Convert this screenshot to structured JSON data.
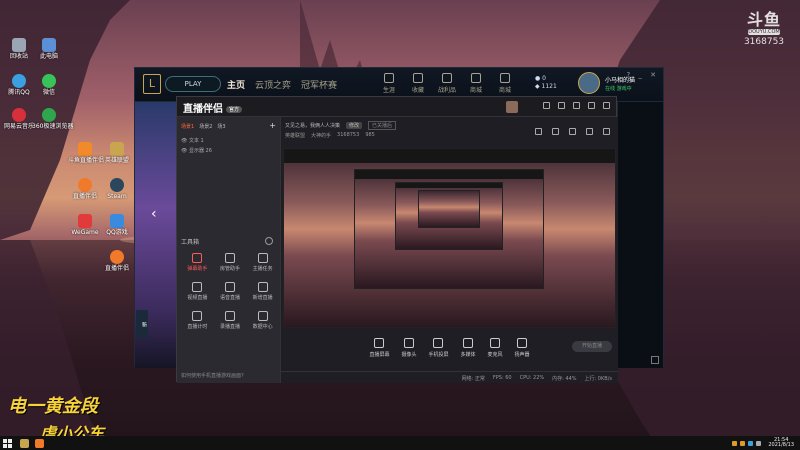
{
  "desktop": {
    "icons": [
      {
        "label": "回收站",
        "color": "#9aa5b5"
      },
      {
        "label": "此电脑",
        "color": "#5b8fd6"
      },
      {
        "label": "腾讯QQ",
        "color": "#3aa0e0"
      },
      {
        "label": "微信",
        "color": "#38c35a"
      },
      {
        "label": "网易云音乐",
        "color": "#d8303a"
      },
      {
        "label": "360极速浏览器",
        "color": "#2fa54e"
      },
      {
        "label": "斗鱼直播伴侣",
        "color": "#f08a2a"
      },
      {
        "label": "英雄联盟",
        "color": "#c8a650"
      },
      {
        "label": "直播伴侣",
        "color": "#f07a2a"
      },
      {
        "label": "Steam",
        "color": "#2a475e"
      },
      {
        "label": "WeGame",
        "color": "#e23a3a"
      },
      {
        "label": "QQ游戏",
        "color": "#3a8ae0"
      },
      {
        "label": "直播伴侣",
        "color": "#f07a2a"
      }
    ],
    "watermark": {
      "logo_text": "斗鱼",
      "sub": "DOUYU.COM",
      "room_number": "3168753"
    },
    "calligraphy": {
      "line1": "电一黄金段",
      "line2": "虐小公车"
    }
  },
  "taskbar": {
    "time": "21:54",
    "date": "2021/8/13"
  },
  "lol_client": {
    "play_label": "PLAY",
    "nav": [
      "主页",
      "云顶之弈",
      "冠军杯赛"
    ],
    "icons": [
      "生涯",
      "收藏",
      "战利品",
      "商城",
      "商城"
    ],
    "currency": {
      "be": "0",
      "rp": "1121"
    },
    "player_name": "小马相的猫",
    "player_status": "在线 游戏中"
  },
  "stream_app": {
    "brand": "直播伴侣",
    "brand_badge": "官方",
    "scene_tabs": [
      "场景1",
      "场景2",
      "场3"
    ],
    "sources": [
      "文本 1",
      "显示器 26"
    ],
    "tools_label": "工具箱",
    "tools": [
      {
        "label": "弹幕助手",
        "active": true
      },
      {
        "label": "房管助手",
        "active": false
      },
      {
        "label": "主播任务",
        "active": false
      },
      {
        "label": "视频直播",
        "active": false
      },
      {
        "label": "语音直播",
        "active": false
      },
      {
        "label": "新增直播",
        "active": false
      },
      {
        "label": "直播计时",
        "active": false
      },
      {
        "label": "录播直播",
        "active": false
      },
      {
        "label": "数据中心",
        "active": false
      }
    ],
    "hint": "如何使用手机直播游戏画面?",
    "room": {
      "title": "又见之易，我俩人人决策",
      "edit": "修改",
      "input_placeholder": "已关播后",
      "category": "英雄联盟",
      "meta1": "大神的手",
      "meta2": "3168753",
      "meta3": "985"
    },
    "controls": [
      "直播屏幕",
      "摄像头",
      "手机投屏",
      "多媒体",
      "麦克风",
      "扬声器"
    ],
    "go_live": "开始直播",
    "status": [
      "网络: 正常",
      "FPS: 60",
      "CPU: 22%",
      "内存: 44%",
      "上行: 0KB/s"
    ]
  }
}
